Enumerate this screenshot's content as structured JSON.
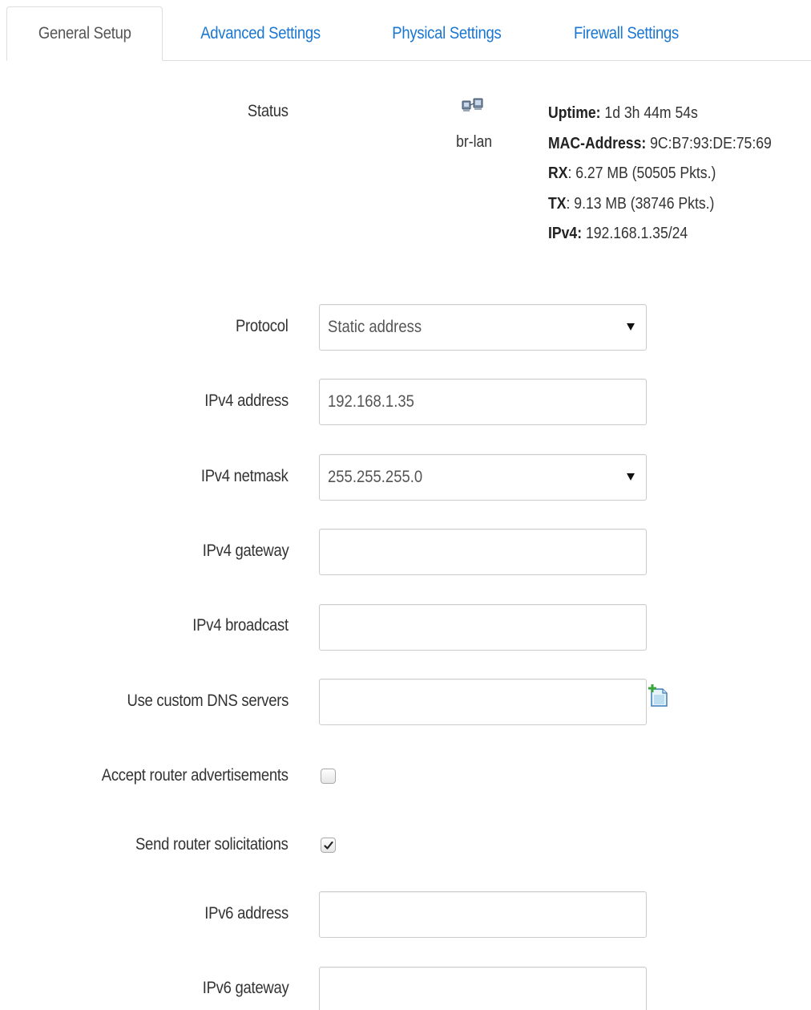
{
  "tabs": [
    {
      "label": "General Setup",
      "active": true
    },
    {
      "label": "Advanced Settings",
      "active": false
    },
    {
      "label": "Physical Settings",
      "active": false
    },
    {
      "label": "Firewall Settings",
      "active": false
    }
  ],
  "status": {
    "label": "Status",
    "interface_name": "br-lan",
    "interface_icon": "network-bridge-icon",
    "uptime_key": "Uptime:",
    "uptime_value": " 1d 3h 44m 54s",
    "mac_key": "MAC-Address:",
    "mac_value": " 9C:B7:93:DE:75:69",
    "rx_key": "RX",
    "rx_value": ": 6.27 MB (50505 Pkts.)",
    "tx_key": "TX",
    "tx_value": ": 9.13 MB (38746 Pkts.)",
    "ipv4_key": "IPv4:",
    "ipv4_value": " 192.168.1.35/24"
  },
  "form": {
    "protocol": {
      "label": "Protocol",
      "value": "Static address"
    },
    "ipv4_address": {
      "label": "IPv4 address",
      "value": "192.168.1.35"
    },
    "ipv4_netmask": {
      "label": "IPv4 netmask",
      "value": "255.255.255.0"
    },
    "ipv4_gateway": {
      "label": "IPv4 gateway",
      "value": ""
    },
    "ipv4_broadcast": {
      "label": "IPv4 broadcast",
      "value": ""
    },
    "custom_dns": {
      "label": "Use custom DNS servers",
      "value": "",
      "add_icon": "add-entry-icon"
    },
    "accept_ra": {
      "label": "Accept router advertisements",
      "checked": false
    },
    "send_rs": {
      "label": "Send router solicitations",
      "checked": true
    },
    "ipv6_address": {
      "label": "IPv6 address",
      "value": ""
    },
    "ipv6_gateway": {
      "label": "IPv6 gateway",
      "value": ""
    }
  },
  "colors": {
    "link": "#1976d2",
    "text": "#333333",
    "border": "#cccccc"
  }
}
